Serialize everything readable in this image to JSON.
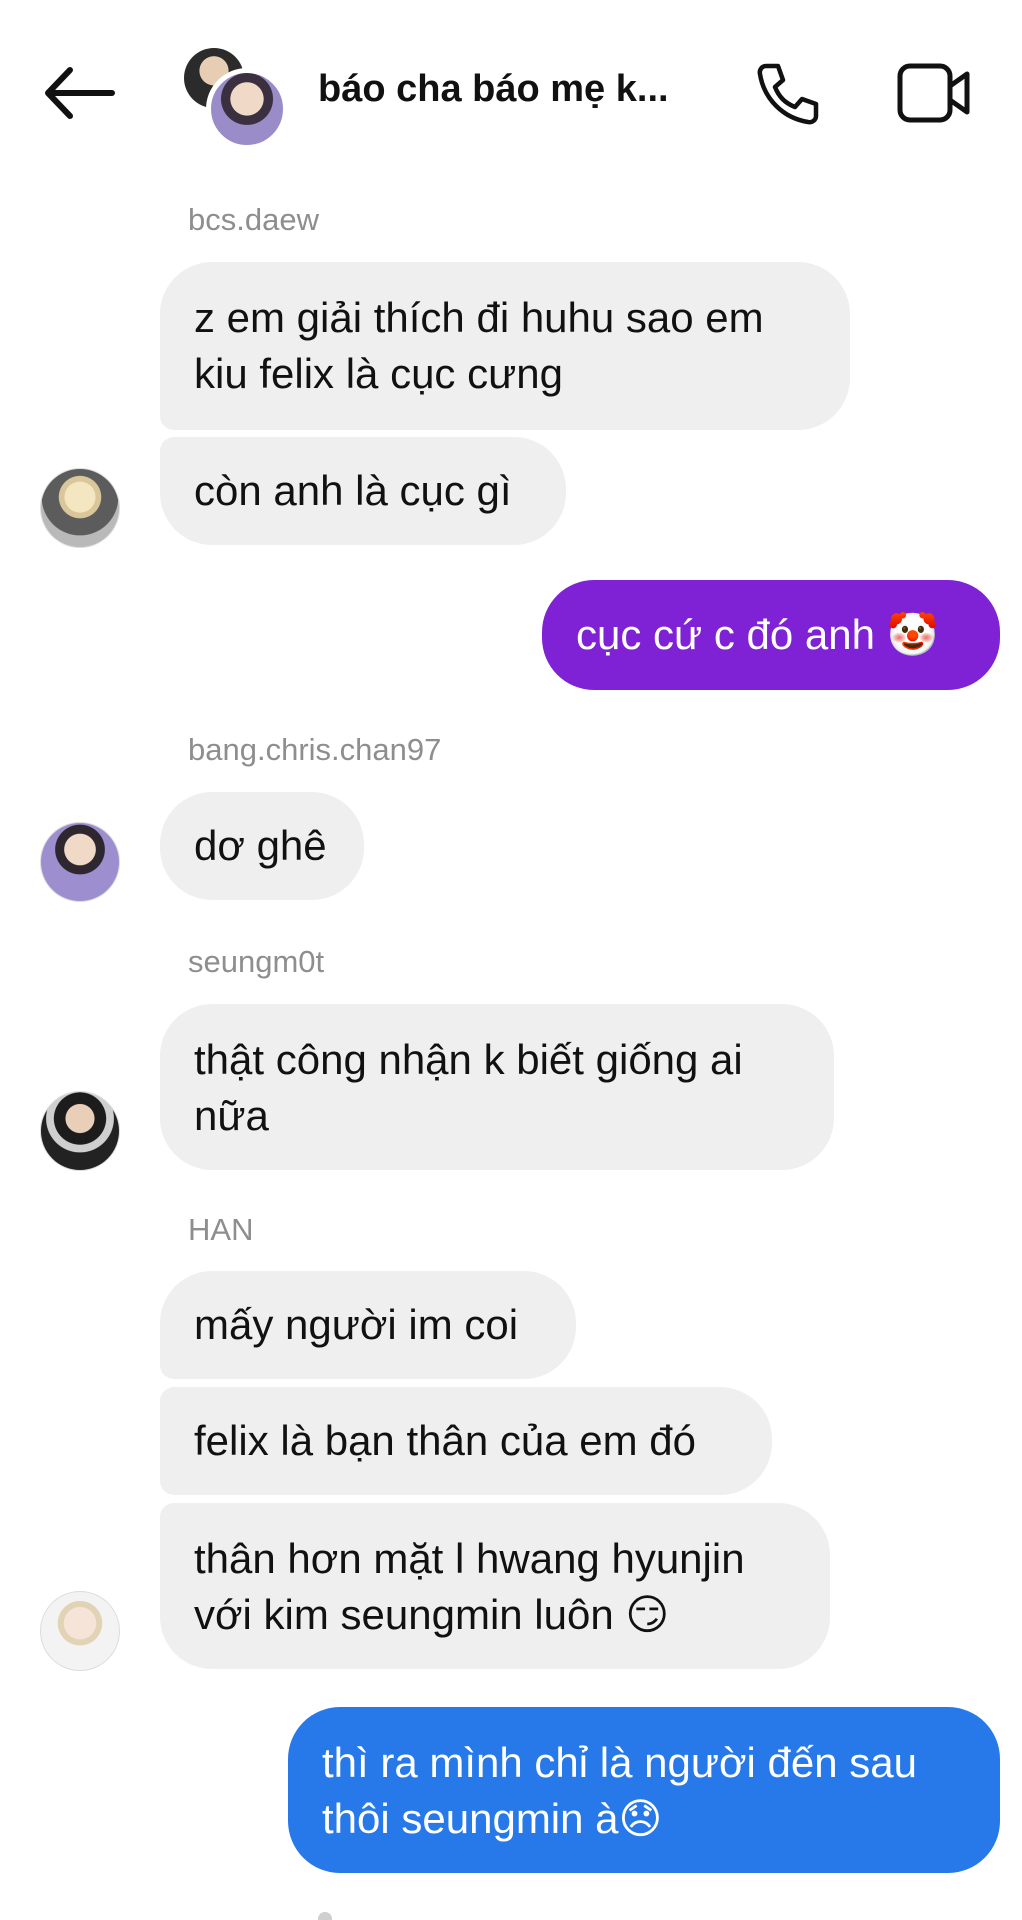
{
  "header": {
    "back_icon": "arrow-left-icon",
    "title": "báo cha báo mẹ k...",
    "call_icon": "phone-icon",
    "video_icon": "video-camera-icon"
  },
  "messages": [
    {
      "sender": "bcs.daew",
      "lines": [
        "z em giải thích đi huhu sao em",
        "kiu felix là cục cưng"
      ]
    },
    {
      "lines": [
        "còn anh là cục gì"
      ]
    },
    {
      "outgoing": true,
      "text": "cục cứ c đó anh",
      "emoji": "🤡",
      "color": "#7f22d6"
    },
    {
      "sender": "bang.chris.chan97",
      "lines": [
        "dơ ghê"
      ]
    },
    {
      "sender": "seungm0t",
      "lines": [
        "thật công nhận k biết giống ai",
        "nữa"
      ]
    },
    {
      "sender": "HAN",
      "lines": [
        "mấy người im coi"
      ]
    },
    {
      "lines": [
        "felix là bạn thân của em đó"
      ]
    },
    {
      "lines": [
        "thân hơn mặt l hwang hyunjin",
        "với kim seungmin luôn"
      ],
      "emoji": "😏"
    },
    {
      "outgoing": true,
      "lines": [
        "thì ra mình chỉ là người đến sau",
        "thôi seungmin à"
      ],
      "emoji": "😞",
      "color": "#2779ea"
    }
  ],
  "colors": {
    "incoming_bubble": "#efefef",
    "sender_label": "#8e8e8e"
  }
}
